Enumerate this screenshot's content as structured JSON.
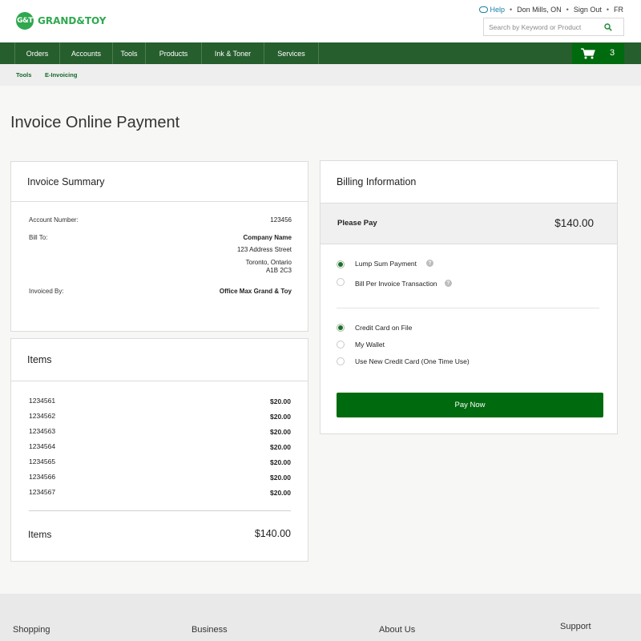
{
  "brand": {
    "logo_mark": "G&T",
    "logo_text": "GRAND&TOY",
    "color": "#2fa84f"
  },
  "utility": {
    "help": "Help",
    "location": "Don Mills, ON",
    "sign_out": "Sign Out",
    "language": "FR"
  },
  "search": {
    "placeholder": "Search by Keyword or Product",
    "icon": "search-icon"
  },
  "nav": {
    "items": [
      "Orders",
      "Accounts",
      "Tools",
      "Products",
      "Ink & Toner",
      "Services"
    ],
    "cart_count": "3",
    "color": "#265e2d"
  },
  "subnav": {
    "tools": "Tools",
    "e_invoicing": "E-Invoicing"
  },
  "page": {
    "title": "Invoice Online Payment"
  },
  "invoice_summary": {
    "title": "Invoice Summary",
    "account_number_label": "Account Number:",
    "account_number": "123456",
    "bill_to_label": "Bill To:",
    "company_name": "Company Name",
    "address_line": "123 Address Street",
    "city": "Toronto, Ontario",
    "postal": "A1B 2C3",
    "invoiced_by_label": "Invoiced By:",
    "invoiced_by": "Office Max Grand & Toy"
  },
  "items": {
    "title": "Items",
    "rows": [
      {
        "id": "1234561",
        "price": "$20.00"
      },
      {
        "id": "1234562",
        "price": "$20.00"
      },
      {
        "id": "1234563",
        "price": "$20.00"
      },
      {
        "id": "1234564",
        "price": "$20.00"
      },
      {
        "id": "1234565",
        "price": "$20.00"
      },
      {
        "id": "1234566",
        "price": "$20.00"
      },
      {
        "id": "1234567",
        "price": "$20.00"
      }
    ],
    "total_label": "Items",
    "total": "$140.00"
  },
  "billing": {
    "title": "Billing Information",
    "please_pay_label": "Please Pay",
    "please_pay_amount": "$140.00",
    "payment_modes": [
      {
        "label": "Lump Sum Payment",
        "selected": true
      },
      {
        "label": "Bill Per Invoice Transaction",
        "selected": false
      }
    ],
    "payment_methods": [
      {
        "label": "Credit Card on File",
        "selected": true
      },
      {
        "label": "My Wallet",
        "selected": false
      },
      {
        "label": "Use New Credit Card (One Time Use)",
        "selected": false
      }
    ],
    "pay_button": "Pay Now",
    "help_glyph": "?"
  },
  "footer": {
    "headings": [
      "Shopping",
      "Business",
      "About Us",
      "Support"
    ]
  }
}
